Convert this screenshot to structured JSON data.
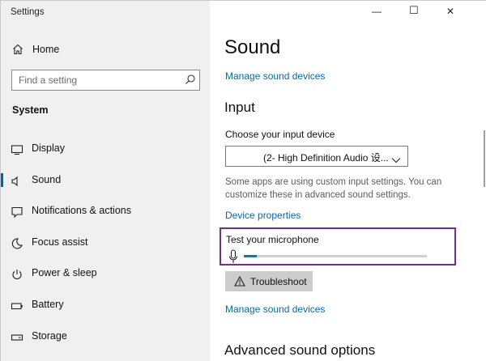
{
  "app": {
    "title": "Settings"
  },
  "window_controls": {
    "minimize": "—",
    "maximize": "☐",
    "close": "✕"
  },
  "sidebar": {
    "home_label": "Home",
    "search_placeholder": "Find a setting",
    "section_title": "System",
    "items": [
      {
        "label": "Display",
        "icon": "display-icon"
      },
      {
        "label": "Sound",
        "icon": "speaker-icon",
        "active": true
      },
      {
        "label": "Notifications & actions",
        "icon": "notifications-icon"
      },
      {
        "label": "Focus assist",
        "icon": "moon-icon"
      },
      {
        "label": "Power & sleep",
        "icon": "power-icon"
      },
      {
        "label": "Battery",
        "icon": "battery-icon"
      },
      {
        "label": "Storage",
        "icon": "storage-icon"
      }
    ]
  },
  "main": {
    "title": "Sound",
    "manage_devices_top": "Manage sound devices",
    "input_heading": "Input",
    "choose_input_label": "Choose your input device",
    "input_device_value": "(2- High Definition Audio 设...",
    "note": "Some apps are using custom input settings. You can customize these in advanced sound settings.",
    "device_properties": "Device properties",
    "test_mic_label": "Test your microphone",
    "mic_level_percent": 7,
    "troubleshoot_label": "Troubleshoot",
    "manage_devices_bottom": "Manage sound devices",
    "advanced_heading": "Advanced sound options"
  },
  "colors": {
    "accent": "#0078d7",
    "link": "#0067b8",
    "highlight_border": "#7b2a8f",
    "sidebar_bg": "#f0f0f0"
  }
}
